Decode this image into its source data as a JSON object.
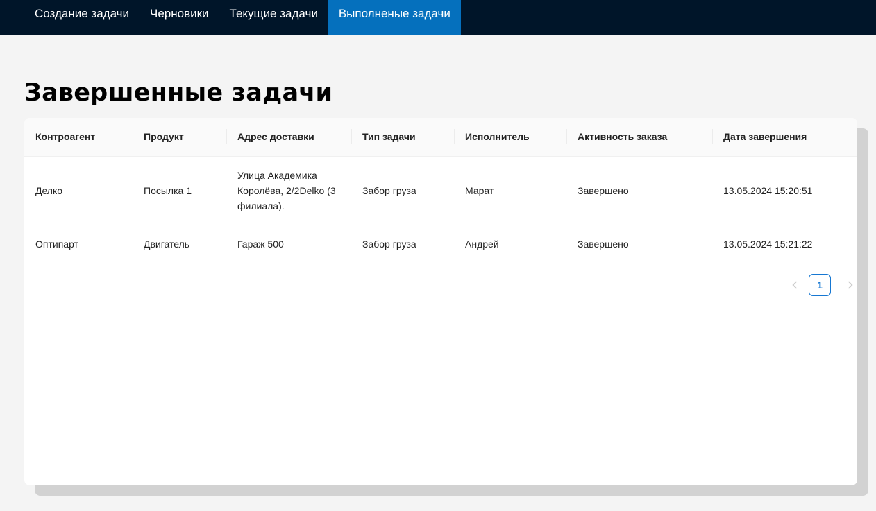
{
  "nav": {
    "items": [
      {
        "label": "Создание задачи"
      },
      {
        "label": "Черновики"
      },
      {
        "label": "Текущие задачи"
      },
      {
        "label": "Выполненые задачи"
      }
    ]
  },
  "page": {
    "title": "Завершенные задачи"
  },
  "table": {
    "columns": [
      "Контроагент",
      "Продукт",
      "Адрес доставки",
      "Тип задачи",
      "Исполнитель",
      "Активность заказа",
      "Дата завершения"
    ],
    "rows": [
      [
        "Делко",
        "Посылка 1",
        "Улица Академика Королёва, 2/2Delko (3 филиала).",
        "Забор груза",
        "Марат",
        "Завершено",
        "13.05.2024 15:20:51"
      ],
      [
        "Оптипарт",
        "Двигатель",
        "Гараж 500",
        "Забор груза",
        "Андрей",
        "Завершено",
        "13.05.2024 15:21:22"
      ]
    ]
  },
  "pagination": {
    "prev_icon": "chevron-left-icon",
    "current_page": "1",
    "next_icon": "chevron-right-icon"
  },
  "colors": {
    "nav_bg": "#001529",
    "nav_active_bg": "#0570bd",
    "page_bg": "#f4f4f4",
    "accent": "#1677d2"
  }
}
